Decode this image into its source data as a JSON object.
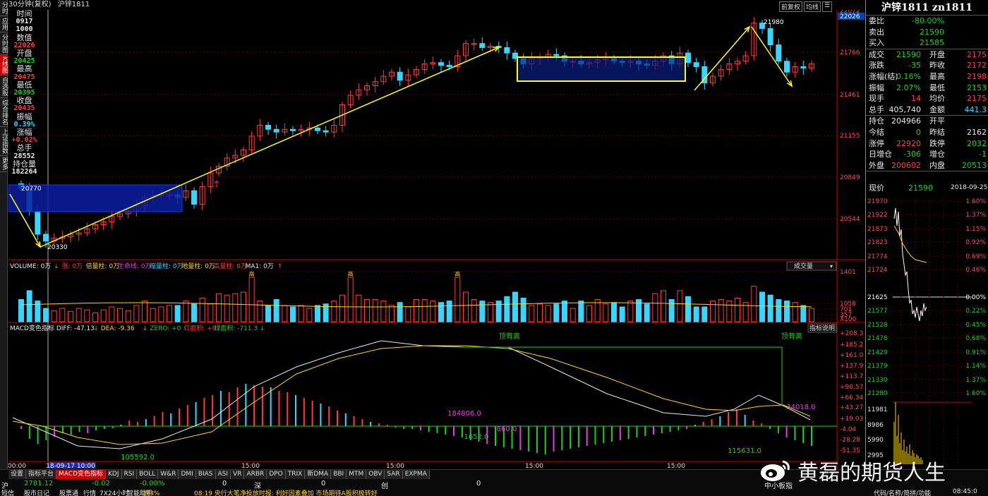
{
  "window": {
    "period": "30分钟(复权)",
    "symbol": "沪锌1811",
    "buttons": [
      "前复权",
      "均线",
      "☰"
    ]
  },
  "leftnav": [
    "分时",
    "应用",
    "分时图",
    "K线图",
    "自选股",
    "综合排名",
    "上证指数",
    "更多"
  ],
  "infocol": [
    {
      "l": "时间",
      "v": "0917",
      "c": "white"
    },
    {
      "l": "",
      "v": "1000",
      "c": "white"
    },
    {
      "l": "数值",
      "v": "22026",
      "c": "red"
    },
    {
      "l": "开盘",
      "v": "20425",
      "c": "green"
    },
    {
      "l": "最高",
      "v": "20475",
      "c": "red"
    },
    {
      "l": "最低",
      "v": "20395",
      "c": "green"
    },
    {
      "l": "收盘",
      "v": "20435",
      "c": "red"
    },
    {
      "l": "振幅",
      "v": "0.39%",
      "c": "cyan"
    },
    {
      "l": "涨幅",
      "v": "+0.02%",
      "c": "red"
    },
    {
      "l": "总手",
      "v": "28552",
      "c": "white"
    },
    {
      "l": "持仓量",
      "v": "182264",
      "c": "white"
    }
  ],
  "kline": {
    "price_axis": [
      "22072",
      "22026",
      "21766",
      "21461",
      "21155",
      "20849",
      "20544"
    ],
    "low_label": "20330",
    "high_label": "21980",
    "left_label": "20770",
    "arrow_mark": "↑"
  },
  "volume": {
    "legend": [
      {
        "t": "VOLUME: 0万",
        "c": "white"
      },
      {
        "t": "↓",
        "c": "green"
      },
      {
        "t": "涨: 0万",
        "c": "red"
      },
      {
        "t": "倍量柱: 0万",
        "c": "yellow"
      },
      {
        "t": "生命线: 0万",
        "c": "magenta"
      },
      {
        "t": "缩量柱: 0万",
        "c": "cyan"
      },
      {
        "t": "地量柱: 0万",
        "c": "yellow"
      },
      {
        "t": "高量柱: 0万",
        "c": "red"
      },
      {
        "t": "MA1: 0万",
        "c": "white"
      },
      {
        "t": "↑",
        "c": "red"
      }
    ],
    "dropdown": "成交量",
    "axis": [
      "1401",
      "1058",
      "701",
      "357",
      "X100"
    ],
    "bar_label": "高"
  },
  "macd": {
    "legend": [
      {
        "t": "MACD变色指标 DIFF: -47.13",
        "c": "white"
      },
      {
        "t": "↓",
        "c": "green"
      },
      {
        "t": "DEA: -9.36",
        "c": "yellow"
      },
      {
        "t": "↓",
        "c": "green"
      },
      {
        "t": "ZERO: +0",
        "c": "green"
      },
      {
        "t": "红面积: +0",
        "c": "red"
      },
      {
        "t": "绿面积: -711.3",
        "c": "green"
      },
      {
        "t": "↓",
        "c": "green"
      }
    ],
    "explain": "指标说明",
    "axis": [
      "+208.3",
      "+185.2",
      "+161.0",
      "+137.9",
      "+113.7",
      "+90.57",
      "+66.34",
      "+43.27",
      "+19.03",
      "-4.04",
      "-28.28",
      "-51.35"
    ],
    "labels": [
      {
        "t": "顶背离",
        "c": "green"
      },
      {
        "t": "顶背离",
        "c": "green"
      },
      {
        "t": "184806.0",
        "c": "magenta"
      },
      {
        "t": "1652.0",
        "c": "green"
      },
      {
        "t": "105592.0",
        "c": "green"
      },
      {
        "t": "115631.0",
        "c": "green"
      },
      {
        "t": "34018.0",
        "c": "magenta"
      },
      {
        "t": "860.0",
        "c": "magenta"
      }
    ],
    "time_axis": [
      "00:00",
      "18-09-17 10:00",
      "15:00",
      "15:00",
      "15:00",
      "15:00"
    ]
  },
  "tabs": [
    "设置",
    "指标平台",
    "MACD变色指标",
    "KDJ",
    "RSI",
    "BOLL",
    "W&R",
    "DMI",
    "BIAS",
    "ASI",
    "VR",
    "ARBR",
    "DPO",
    "TRIX",
    "新DMA",
    "BBI",
    "MTM",
    "OBV",
    "SAR",
    "EXPMA"
  ],
  "statusbar": {
    "row1": [
      {
        "t": "沪",
        "c": "white"
      },
      {
        "t": "2781.12",
        "c": "green"
      },
      {
        "t": "-0.02",
        "c": "green"
      },
      {
        "t": "-0.00%",
        "c": "green"
      },
      {
        "t": "0",
        "c": "white"
      },
      {
        "t": "深",
        "c": "white"
      },
      {
        "t": "0",
        "c": "white"
      },
      {
        "t": "创",
        "c": "white"
      },
      {
        "t": "0",
        "c": "white"
      },
      {
        "t": "中小板指",
        "c": "white"
      }
    ],
    "row2": [
      {
        "t": "短信",
        "c": "white"
      },
      {
        "t": "股市日记",
        "c": "white"
      },
      {
        "t": "股票通",
        "c": "white"
      },
      {
        "t": "行情",
        "c": "white"
      },
      {
        "t": "7X24小时",
        "c": "white"
      },
      {
        "t": "智能助手",
        "c": "white"
      },
      {
        "t": "跌3%",
        "c": "yellow"
      },
      {
        "t": "08:19 央行大笔净投放时报: 利好因素叠加 市场期待A股积极转好",
        "c": "yellow"
      },
      {
        "t": "代码/名称/简拼/功能",
        "c": "white"
      },
      {
        "t": "08:45:0",
        "c": "white"
      }
    ]
  },
  "right": {
    "title": "沪锌1811 zn1811",
    "rows1": [
      [
        {
          "t": "委比",
          "c": "white"
        },
        {
          "t": "-80.00%",
          "c": "green"
        }
      ],
      [
        {
          "t": "卖出",
          "c": "white"
        },
        {
          "t": "21590",
          "c": "green"
        }
      ],
      [
        {
          "t": "买入",
          "c": "white"
        },
        {
          "t": "21585",
          "c": "green"
        }
      ]
    ],
    "rows2": [
      [
        {
          "t": "成交",
          "c": "white"
        },
        {
          "t": "21590",
          "c": "green"
        },
        {
          "t": "开盘",
          "c": "white"
        },
        {
          "t": "2175",
          "c": "red"
        }
      ],
      [
        {
          "t": "涨跌",
          "c": "white"
        },
        {
          "t": "-35",
          "c": "green"
        },
        {
          "t": "昨收",
          "c": "white"
        },
        {
          "t": "2172",
          "c": "red"
        }
      ],
      [
        {
          "t": "涨幅(结)",
          "c": "white"
        },
        {
          "t": "-0.16%",
          "c": "green"
        },
        {
          "t": "最高",
          "c": "white"
        },
        {
          "t": "2198",
          "c": "red"
        }
      ],
      [
        {
          "t": "振幅",
          "c": "white"
        },
        {
          "t": "2.07%",
          "c": "green"
        },
        {
          "t": "最低",
          "c": "white"
        },
        {
          "t": "2153",
          "c": "green"
        }
      ],
      [
        {
          "t": "现手",
          "c": "white"
        },
        {
          "t": "14",
          "c": "red"
        },
        {
          "t": "均价",
          "c": "white"
        },
        {
          "t": "2175",
          "c": "red"
        }
      ],
      [
        {
          "t": "总手",
          "c": "white"
        },
        {
          "t": "405,740",
          "c": "white"
        },
        {
          "t": "金额",
          "c": "white"
        },
        {
          "t": "441.3",
          "c": "cyan"
        }
      ]
    ],
    "rows3": [
      [
        {
          "t": "持仓",
          "c": "white"
        },
        {
          "t": "204966",
          "c": "white"
        },
        {
          "t": "开平",
          "c": "white"
        },
        {
          "t": "",
          "c": "white"
        }
      ],
      [
        {
          "t": "今结",
          "c": "white"
        },
        {
          "t": "0",
          "c": "green"
        },
        {
          "t": "昨结",
          "c": "white"
        },
        {
          "t": "2162",
          "c": "white"
        }
      ],
      [
        {
          "t": "涨停",
          "c": "white"
        },
        {
          "t": "22920",
          "c": "red"
        },
        {
          "t": "跌停",
          "c": "white"
        },
        {
          "t": "2032",
          "c": "green"
        }
      ],
      [
        {
          "t": "日增仓",
          "c": "white"
        },
        {
          "t": "-306",
          "c": "green"
        },
        {
          "t": "增仓",
          "c": "white"
        },
        {
          "t": "-1",
          "c": "green"
        }
      ],
      [
        {
          "t": "外盘",
          "c": "white"
        },
        {
          "t": "200602",
          "c": "red"
        },
        {
          "t": "内盘",
          "c": "white"
        },
        {
          "t": "20513",
          "c": "green"
        }
      ]
    ],
    "current": [
      {
        "t": "现价",
        "c": "white"
      },
      {
        "t": "21590",
        "c": "green"
      },
      {
        "t": "2018-09-25,",
        "c": "white"
      }
    ],
    "mini_left": [
      "21970",
      "21922",
      "21873",
      "21823",
      "21774",
      "21724",
      "21625",
      "21577",
      "21528",
      "21478",
      "21429",
      "21379",
      "21330",
      "21280",
      "11981",
      "8986",
      "5990",
      "2995"
    ],
    "mini_right": [
      "1.60%",
      "1.37%",
      "1.15%",
      "0.92%",
      "0.69%",
      "0.46%",
      "0.00%",
      "0.22%",
      "0.45%",
      "0.68%",
      "0.91%",
      "1.14%",
      "1.37%",
      "1.60%"
    ]
  },
  "watermark": "黄磊的期货人生"
}
